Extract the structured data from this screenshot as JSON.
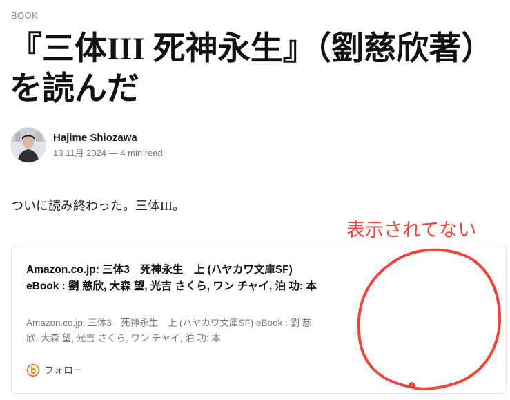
{
  "post": {
    "tag": "BOOK",
    "title": "『三体III 死神永生』（劉慈欣著）を読んだ",
    "author": "Hajime Shiozawa",
    "meta": "13 11月 2024 — 4 min read",
    "intro": "ついに読み終わった。三体III。"
  },
  "annotation": {
    "text": "表示されてない",
    "color": "#f0443a"
  },
  "bookmark_card": {
    "title": "Amazon.co.jp: 三体3　死神永生　上 (ハヤカワ文庫SF) eBook : 劉 慈欣, 大森 望, 光吉 さくら, ワン チャイ, 泊 功: 本",
    "description": "Amazon.co.jp: 三体3　死神永生　上 (ハヤカワ文庫SF) eBook : 劉 慈欣, 大森 望, 光吉 さくら, ワン チャイ, 泊 功: 本",
    "source": "フォロー",
    "source_icon": "bookwalker-b-icon",
    "thumbnail_missing": true
  },
  "colors": {
    "background": "#ffffff",
    "text": "#111111",
    "muted": "#777777",
    "annotation_red": "#f0443a",
    "card_border": "#e6e6e6"
  }
}
